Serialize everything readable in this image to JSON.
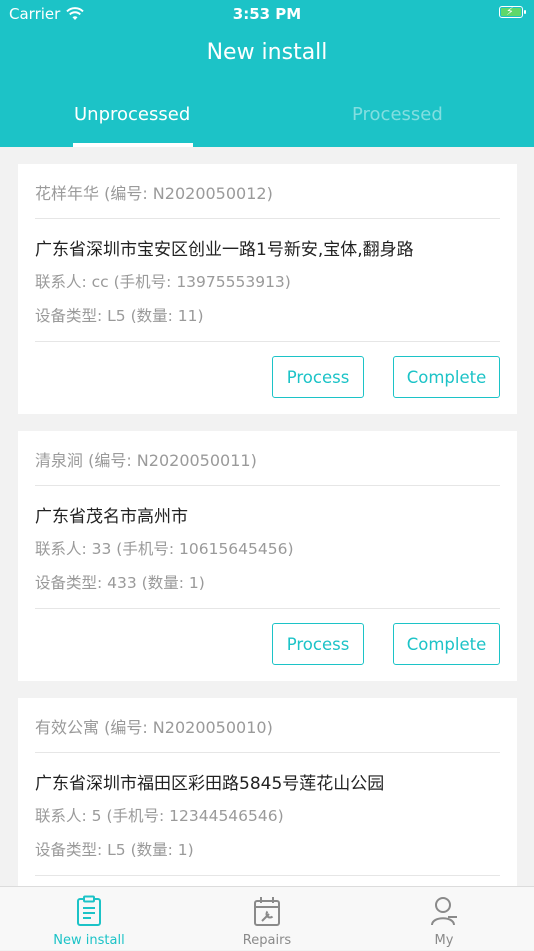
{
  "status_bar": {
    "carrier": "Carrier",
    "time": "3:53 PM"
  },
  "nav": {
    "title": "New install"
  },
  "tabs": [
    {
      "label": "Unprocessed",
      "active": true
    },
    {
      "label": "Processed",
      "active": false
    }
  ],
  "colors": {
    "accent": "#1cc3c7",
    "battery": "#5fd86a"
  },
  "orders": [
    {
      "header": "花样年华 (编号: N2020050012)",
      "address": "广东省深圳市宝安区创业一路1号新安,宝体,翻身路",
      "contact": "联系人: cc (手机号: 13975553913)",
      "device": "设备类型: L5 (数量: 11)",
      "process_label": "Process",
      "complete_label": "Complete"
    },
    {
      "header": "清泉涧 (编号: N2020050011)",
      "address": "广东省茂名市高州市",
      "contact": "联系人: 33 (手机号: 10615645456)",
      "device": "设备类型: 433 (数量: 1)",
      "process_label": "Process",
      "complete_label": "Complete"
    },
    {
      "header": "有效公寓 (编号: N2020050010)",
      "address": "广东省深圳市福田区彩田路5845号莲花山公园",
      "contact": "联系人: 5 (手机号: 12344546546)",
      "device": "设备类型: L5 (数量: 1)"
    }
  ],
  "tabbar": [
    {
      "label": "New install",
      "icon": "clipboard-icon",
      "active": true
    },
    {
      "label": "Repairs",
      "icon": "repairs-calendar-icon",
      "active": false
    },
    {
      "label": "My",
      "icon": "person-icon",
      "active": false
    }
  ]
}
